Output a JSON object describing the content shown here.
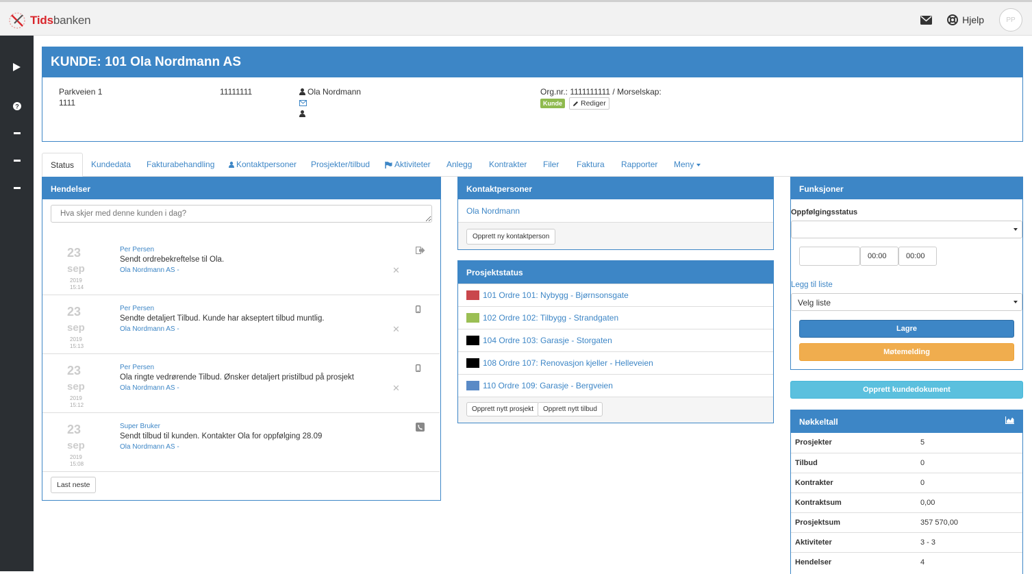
{
  "app": {
    "brand_bold": "Tids",
    "brand_rest": "banken",
    "help_label": "Hjelp",
    "avatar_initials": "PP"
  },
  "customer": {
    "title": "KUNDE: 101 Ola Nordmann AS",
    "address_line1": "Parkveien 1",
    "address_line2": "1111",
    "phone": "11111111",
    "contact_name": "Ola Nordmann",
    "orgnr": "Org.nr.: 1111111111 / Morselskap:",
    "badge": "Kunde",
    "edit_label": "Rediger"
  },
  "tabs": [
    "Status",
    "Kundedata",
    "Fakturabehandling",
    "Kontaktpersoner",
    "Prosjekter/tilbud",
    "Aktiviteter",
    "Anlegg",
    "Kontrakter",
    "Filer",
    "Faktura",
    "Rapporter",
    "Meny"
  ],
  "events_panel": {
    "title": "Hendelser",
    "placeholder": "Hva skjer med denne kunden i dag?",
    "more_label": "Last neste",
    "items": [
      {
        "day": "23",
        "month": "sep",
        "year": "2019",
        "time": "15:14",
        "user": "Per Persen",
        "text": "Sendt ordrebekreftelse til Ola.",
        "customer": "Ola Nordmann AS -",
        "icon": "sign-out-icon",
        "removable": true
      },
      {
        "day": "23",
        "month": "sep",
        "year": "2019",
        "time": "15:13",
        "user": "Per Persen",
        "text": "Sendte detaljert Tilbud. Kunde har akseptert tilbud muntlig.",
        "customer": "Ola Nordmann AS -",
        "icon": "mobile-icon",
        "removable": true
      },
      {
        "day": "23",
        "month": "sep",
        "year": "2019",
        "time": "15:12",
        "user": "Per Persen",
        "text": "Ola ringte vedrørende Tilbud. Ønsker detaljert pristilbud på prosjekt",
        "customer": "Ola Nordmann AS -",
        "icon": "mobile-icon",
        "removable": true
      },
      {
        "day": "23",
        "month": "sep",
        "year": "2019",
        "time": "15:08",
        "user": "Super Bruker",
        "text": "Sendt tilbud til kunden. Kontakter Ola for oppfølging 28.09",
        "customer": "Ola Nordmann AS -",
        "icon": "phone-icon",
        "removable": false
      }
    ]
  },
  "contacts_panel": {
    "title": "Kontaktpersoner",
    "contacts": [
      "Ola Nordmann"
    ],
    "new_label": "Opprett ny kontaktperson"
  },
  "projects_panel": {
    "title": "Prosjektstatus",
    "projects": [
      {
        "label": "101 Ordre 101: Nybygg - Bjørnsonsgate",
        "color": "#c9474c"
      },
      {
        "label": "102 Ordre 102: Tilbygg - Strandgaten",
        "color": "#9bbf54"
      },
      {
        "label": "104 Ordre 103: Garasje - Storgaten",
        "color": "#000000"
      },
      {
        "label": "108 Ordre 107: Renovasjon kjeller - Helleveien",
        "color": "#000000"
      },
      {
        "label": "110 Ordre 109: Garasje - Bergveien",
        "color": "#5a8ac6"
      }
    ],
    "new_project_label": "Opprett nytt prosjekt",
    "new_offer_label": "Opprett nytt tilbud"
  },
  "functions_panel": {
    "title": "Funksjoner",
    "followup_label": "Oppfølgingsstatus",
    "followup_value": "",
    "date_value": "",
    "time_from": "00:00",
    "time_to": "00:00",
    "add_list_label": "Legg til liste",
    "list_value": "Velg liste",
    "save_label": "Lagre",
    "meeting_label": "Møtemelding"
  },
  "create_doc_label": "Opprett kundedokument",
  "kpi_panel": {
    "title": "Nøkkeltall",
    "rows": [
      {
        "label": "Prosjekter",
        "value": "5"
      },
      {
        "label": "Tilbud",
        "value": "0"
      },
      {
        "label": "Kontrakter",
        "value": "0"
      },
      {
        "label": "Kontraktsum",
        "value": "0,00"
      },
      {
        "label": "Prosjektsum",
        "value": "357 570,00"
      },
      {
        "label": "Aktiviteter",
        "value": "3 - 3"
      },
      {
        "label": "Hendelser",
        "value": "4"
      }
    ]
  },
  "colors": {
    "primary": "#3d86c6",
    "success": "#8fba4e",
    "warning": "#f0ad4e",
    "info": "#5bc0de",
    "sidebar": "#2b2f33"
  }
}
